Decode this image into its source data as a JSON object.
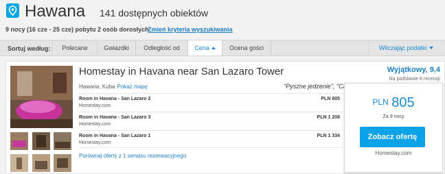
{
  "header": {
    "city": "Hawana",
    "count_text": "141 dostępnych obiektów",
    "stay_info": "9 nocy (16 cze - 25 cze) pobytu 2 osób dorosłych",
    "change_link": "Zmień kryteria wyszukiwania"
  },
  "sortbar": {
    "label": "Sortuj według:",
    "options": [
      "Polecane",
      "Gwiazdki",
      "Odległość od",
      "Cena",
      "Ocena gości"
    ],
    "active_option": "Cena",
    "tax_toggle": "Wliczając podatki"
  },
  "hotel": {
    "name": "Homestay in Havana near San Lazaro Tower",
    "location": "Hawana, Kuba",
    "map_link": "Pokaż mapę",
    "quote": "\"Pyszne jedzenie\", \"Ca",
    "rating_text": "Wyjątkowy, 9,4",
    "rating_basis": "Na podstawie 6 recenzji",
    "offers": [
      {
        "name": "Room in Havana - San Lazaro 2",
        "site": "Homestay.com",
        "price": "PLN 805"
      },
      {
        "name": "Room in Havana - San Lazaro 3",
        "site": "Homestay.com",
        "price": "PLN 1 208"
      },
      {
        "name": "Room in Havana - San Lazaro 1",
        "site": "Homestay.com",
        "price": "PLN 1 334"
      }
    ],
    "compare_link": "Porównaj oferty z 1 serwisu rezerwacyjnego",
    "best_price": {
      "currency": "PLN",
      "amount": "805",
      "nights": "Za 9 nocy",
      "cta": "Zobacz ofertę",
      "site": "Homestay.com"
    }
  },
  "colors": {
    "accent": "#1a8ad6",
    "cta": "#0aa2e8",
    "link": "#1a7ec4"
  }
}
